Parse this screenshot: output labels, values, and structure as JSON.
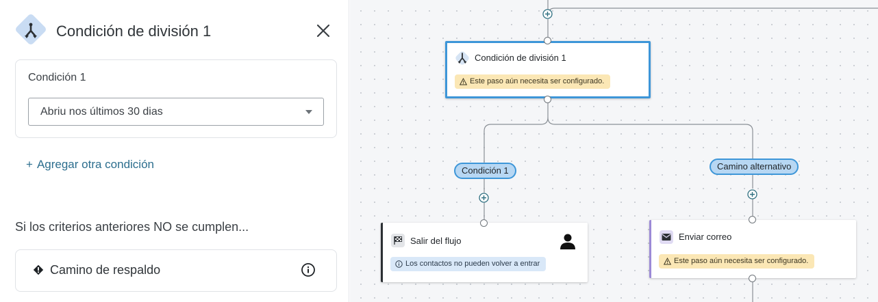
{
  "panel": {
    "title": "Condición de división 1",
    "header_icon": "split-icon",
    "close_icon": "close-icon",
    "condition_card": {
      "label": "Condición 1",
      "select_value": "Abriu nos últimos 30 dias"
    },
    "add_condition": {
      "plus": "+",
      "label": "Agregar otra condición"
    },
    "fallback_note": "Si los criterios anteriores NO se cumplen...",
    "fallback_card": {
      "label": "Camino de respaldo",
      "warn_icon": "warning-diamond-icon",
      "info_icon": "info-icon"
    }
  },
  "canvas": {
    "split_node": {
      "title": "Condición de división 1",
      "warning": "Este paso aún necesita ser configurado."
    },
    "branch_condition": "Condición 1",
    "branch_alternative": "Camino alternativo",
    "exit_node": {
      "title": "Salir del flujo",
      "info": "Los contactos no pueden volver a entrar",
      "icon": "checkered-flag-icon",
      "avatar": "person-icon"
    },
    "email_node": {
      "title": "Enviar correo",
      "warning": "Este paso aún necesita ser configurado.",
      "icon": "envelope-icon"
    }
  },
  "colors": {
    "accent_blue": "#3d96d8",
    "branch_fill": "#b7d7f3",
    "warning_fill": "#fbe7b5",
    "info_fill": "#d9e8f8",
    "link": "#2c6e8e",
    "email_accent": "#9c8ad6"
  }
}
